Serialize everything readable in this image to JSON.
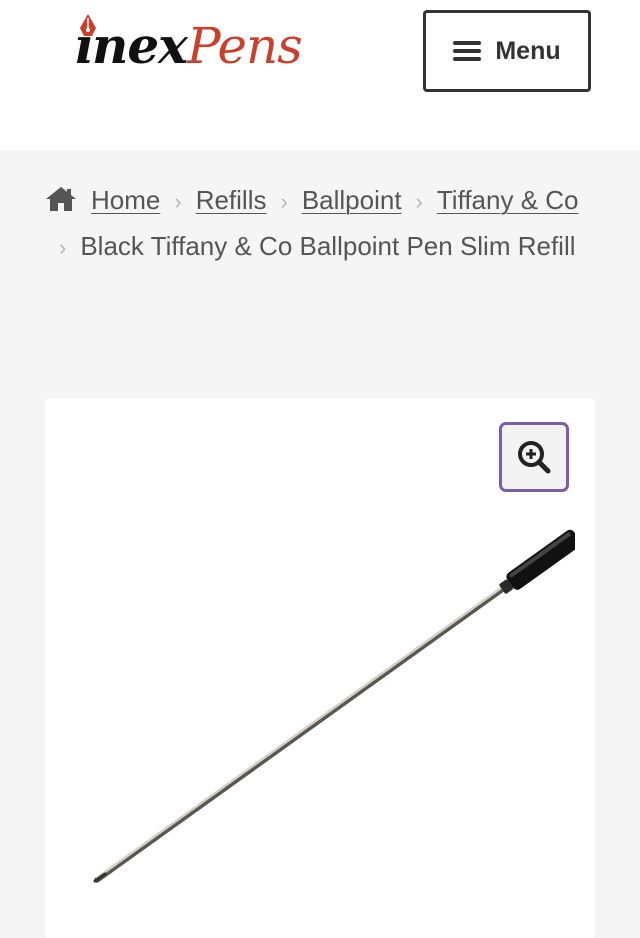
{
  "header": {
    "logo": {
      "part1": "ınex",
      "part2": "Pens"
    },
    "menu_label": "Menu"
  },
  "breadcrumb": {
    "items": [
      {
        "label": "Home"
      },
      {
        "label": "Refills"
      },
      {
        "label": "Ballpoint"
      },
      {
        "label": "Tiffany & Co"
      }
    ],
    "current": "Black Tiffany & Co Ballpoint Pen Slim Refill"
  },
  "product": {
    "zoom_icon": "zoom-in-icon",
    "image_subject": "ballpoint-refill"
  },
  "colors": {
    "logo_red": "#c8402e",
    "logo_dark": "#111111",
    "zoom_border": "#7b5ea7",
    "text": "#555555",
    "page_bg": "#f5f5f5"
  }
}
